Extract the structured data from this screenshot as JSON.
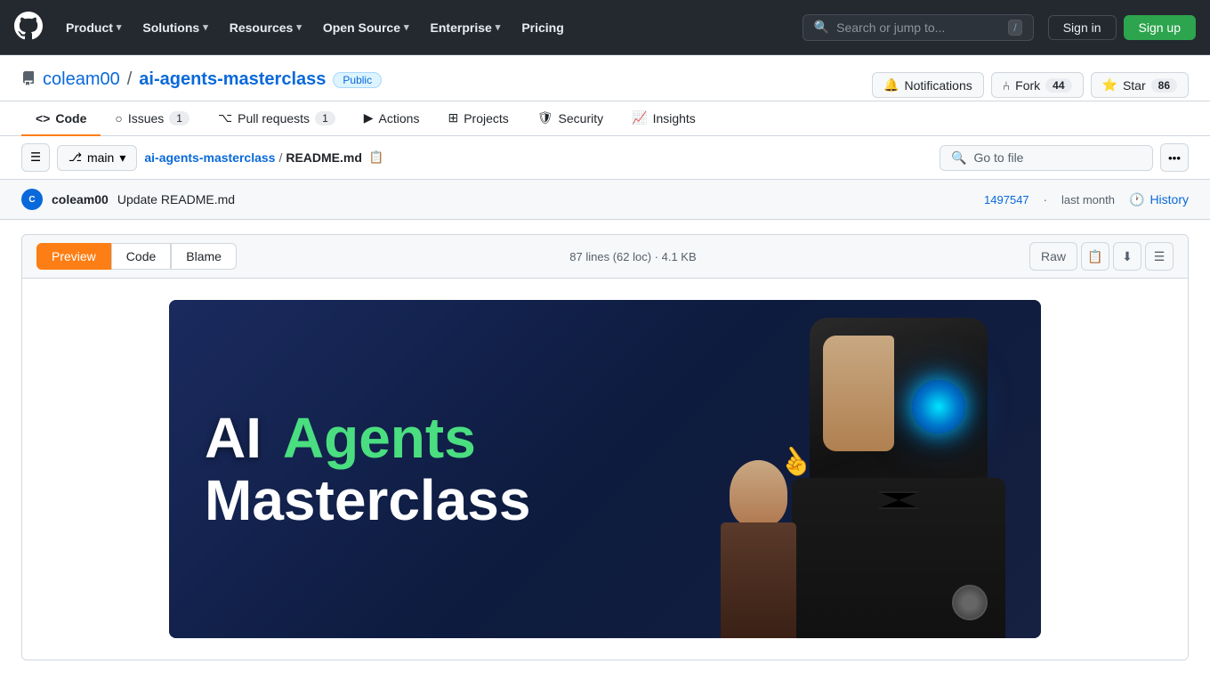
{
  "topnav": {
    "logo_label": "GitHub",
    "items": [
      {
        "label": "Product",
        "has_dropdown": true
      },
      {
        "label": "Solutions",
        "has_dropdown": true
      },
      {
        "label": "Resources",
        "has_dropdown": true
      },
      {
        "label": "Open Source",
        "has_dropdown": true
      },
      {
        "label": "Enterprise",
        "has_dropdown": true
      },
      {
        "label": "Pricing",
        "has_dropdown": false
      }
    ],
    "search_placeholder": "Search or jump to...",
    "search_kbd": "/",
    "signin_label": "Sign in",
    "signup_label": "Sign up"
  },
  "repo": {
    "owner": "coleam00",
    "name": "ai-agents-masterclass",
    "visibility": "Public",
    "notifications_label": "Notifications",
    "fork_label": "Fork",
    "fork_count": "44",
    "star_label": "Star",
    "star_count": "86"
  },
  "tabs": [
    {
      "label": "Code",
      "count": null,
      "active": true
    },
    {
      "label": "Issues",
      "count": "1",
      "active": false
    },
    {
      "label": "Pull requests",
      "count": "1",
      "active": false
    },
    {
      "label": "Actions",
      "count": null,
      "active": false
    },
    {
      "label": "Projects",
      "count": null,
      "active": false
    },
    {
      "label": "Security",
      "count": null,
      "active": false
    },
    {
      "label": "Insights",
      "count": null,
      "active": false
    }
  ],
  "file_nav": {
    "branch": "main",
    "breadcrumb_repo": "ai-agents-masterclass",
    "breadcrumb_file": "README.md",
    "search_placeholder": "Go to file"
  },
  "commit": {
    "author": "coleam00",
    "message": "Update README.md",
    "sha": "1497547",
    "time": "last month",
    "history_label": "History"
  },
  "file_viewer": {
    "tab_preview": "Preview",
    "tab_code": "Code",
    "tab_blame": "Blame",
    "file_info": "87 lines (62 loc) · 4.1 KB",
    "raw_label": "Raw"
  },
  "banner": {
    "line1": "AI",
    "line2": "Agents",
    "line3": "Masterclass"
  }
}
